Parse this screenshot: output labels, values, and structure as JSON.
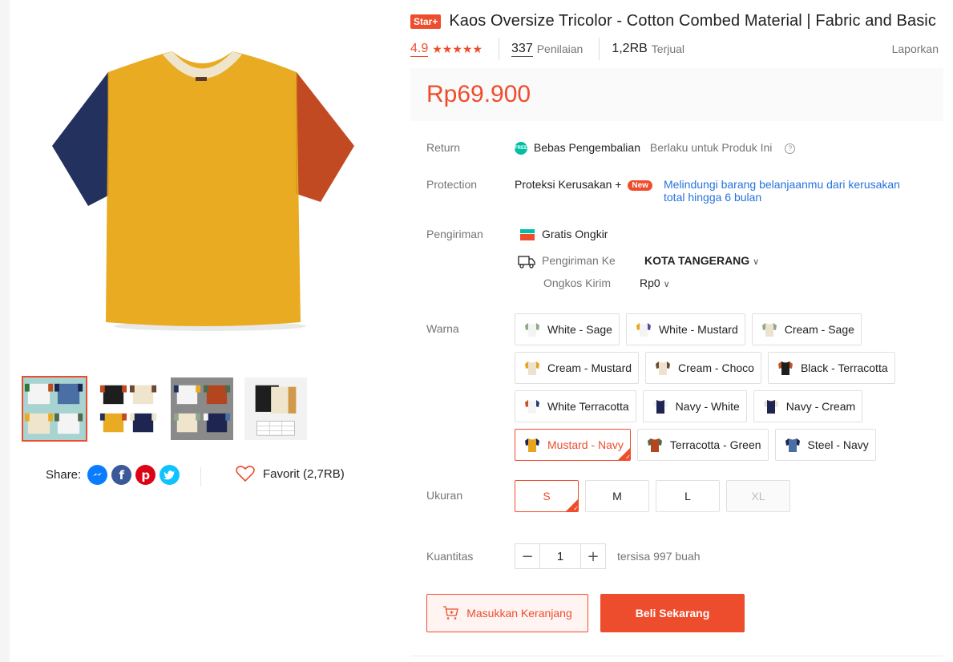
{
  "product": {
    "badge": "Star+",
    "title": "Kaos Oversize Tricolor - Cotton Combed Material | Fabric and Basic",
    "rating": "4.9",
    "stars": "★★★★★",
    "reviews_count": "337",
    "reviews_label": "Penilaian",
    "sold_count": "1,2RB",
    "sold_label": "Terjual",
    "report": "Laporkan",
    "price": "Rp69.900"
  },
  "share": {
    "label": "Share:",
    "favorite": "Favorit (2,7RB)"
  },
  "return": {
    "label": "Return",
    "badge": "FREE",
    "value": "Bebas Pengembalian",
    "note": "Berlaku untuk Produk Ini"
  },
  "protection": {
    "label": "Protection",
    "value": "Proteksi Kerusakan +",
    "badge": "New",
    "line1": "Melindungi barang belanjaanmu dari kerusakan",
    "line2": "total hingga 6 bulan"
  },
  "shipping": {
    "label": "Pengiriman",
    "free": "Gratis Ongkir",
    "to_label": "Pengiriman Ke",
    "to_value": "KOTA TANGERANG",
    "cost_label": "Ongkos Kirim",
    "cost_value": "Rp0"
  },
  "variants": {
    "label": "Warna",
    "rows": [
      [
        {
          "name": "White - Sage",
          "body": "#f4f4f4",
          "s1": "#8fa88a",
          "s2": "#8fa88a"
        },
        {
          "name": "White - Mustard",
          "body": "#f4f4f4",
          "s1": "#e7a51f",
          "s2": "#5b4a9a"
        },
        {
          "name": "Cream - Sage",
          "body": "#ece3cf",
          "s1": "#8fa88a",
          "s2": "#8fa88a"
        }
      ],
      [
        {
          "name": "Cream - Mustard",
          "body": "#ece3cf",
          "s1": "#e7a51f",
          "s2": "#e7a51f"
        },
        {
          "name": "Cream - Choco",
          "body": "#ece3cf",
          "s1": "#6b4a35",
          "s2": "#6b4a35"
        },
        {
          "name": "Black - Terracotta",
          "body": "#1e1e1e",
          "s1": "#c6532a",
          "s2": "#c6532a"
        }
      ],
      [
        {
          "name": "White Terracotta",
          "body": "#f4f4f4",
          "s1": "#c6532a",
          "s2": "#2a3a6e"
        },
        {
          "name": "Navy - White",
          "body": "#1d2550",
          "s1": "#f4f4f4",
          "s2": "#f4f4f4"
        },
        {
          "name": "Navy - Cream",
          "body": "#1d2550",
          "s1": "#ece3cf",
          "s2": "#ece3cf"
        }
      ],
      [
        {
          "name": "Mustard - Navy",
          "body": "#e7a51f",
          "s1": "#1d2550",
          "s2": "#1d2550",
          "selected": true
        },
        {
          "name": "Terracotta - Green",
          "body": "#b3461f",
          "s1": "#4f6b4a",
          "s2": "#4f6b4a"
        },
        {
          "name": "Steel - Navy",
          "body": "#4a6fa5",
          "s1": "#1d2550",
          "s2": "#1d2550"
        }
      ]
    ]
  },
  "sizes": {
    "label": "Ukuran",
    "options": [
      {
        "name": "S",
        "selected": true
      },
      {
        "name": "M"
      },
      {
        "name": "L"
      },
      {
        "name": "XL",
        "disabled": true
      }
    ]
  },
  "quantity": {
    "label": "Kuantitas",
    "minus": "−",
    "value": "1",
    "plus": "+",
    "stock": "tersisa 997 buah"
  },
  "actions": {
    "cart": "Masukkan Keranjang",
    "buy": "Beli Sekarang"
  },
  "colors": {
    "accent": "#ee4d2d",
    "mustard": "#e9ab22",
    "navy": "#22315e",
    "terracotta": "#c24a22",
    "cream": "#efe5cc"
  }
}
